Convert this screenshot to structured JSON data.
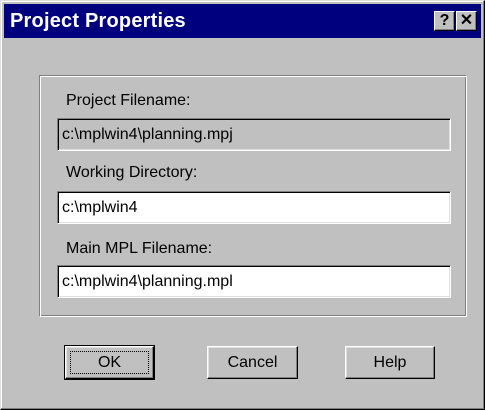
{
  "window": {
    "title": "Project Properties",
    "help_glyph": "?",
    "close_glyph": "✕"
  },
  "form": {
    "project_filename": {
      "label": "Project Filename:",
      "value": "c:\\mplwin4\\planning.mpj",
      "readonly": true
    },
    "working_directory": {
      "label": "Working Directory:",
      "value": "c:\\mplwin4"
    },
    "main_mpl_filename": {
      "label": "Main MPL Filename:",
      "value": "c:\\mplwin4\\planning.mpl"
    }
  },
  "buttons": {
    "ok": "OK",
    "cancel": "Cancel",
    "help": "Help"
  },
  "colors": {
    "titlebar": "#00007f",
    "face": "#c0c0c0",
    "field_bg": "#ffffff"
  }
}
